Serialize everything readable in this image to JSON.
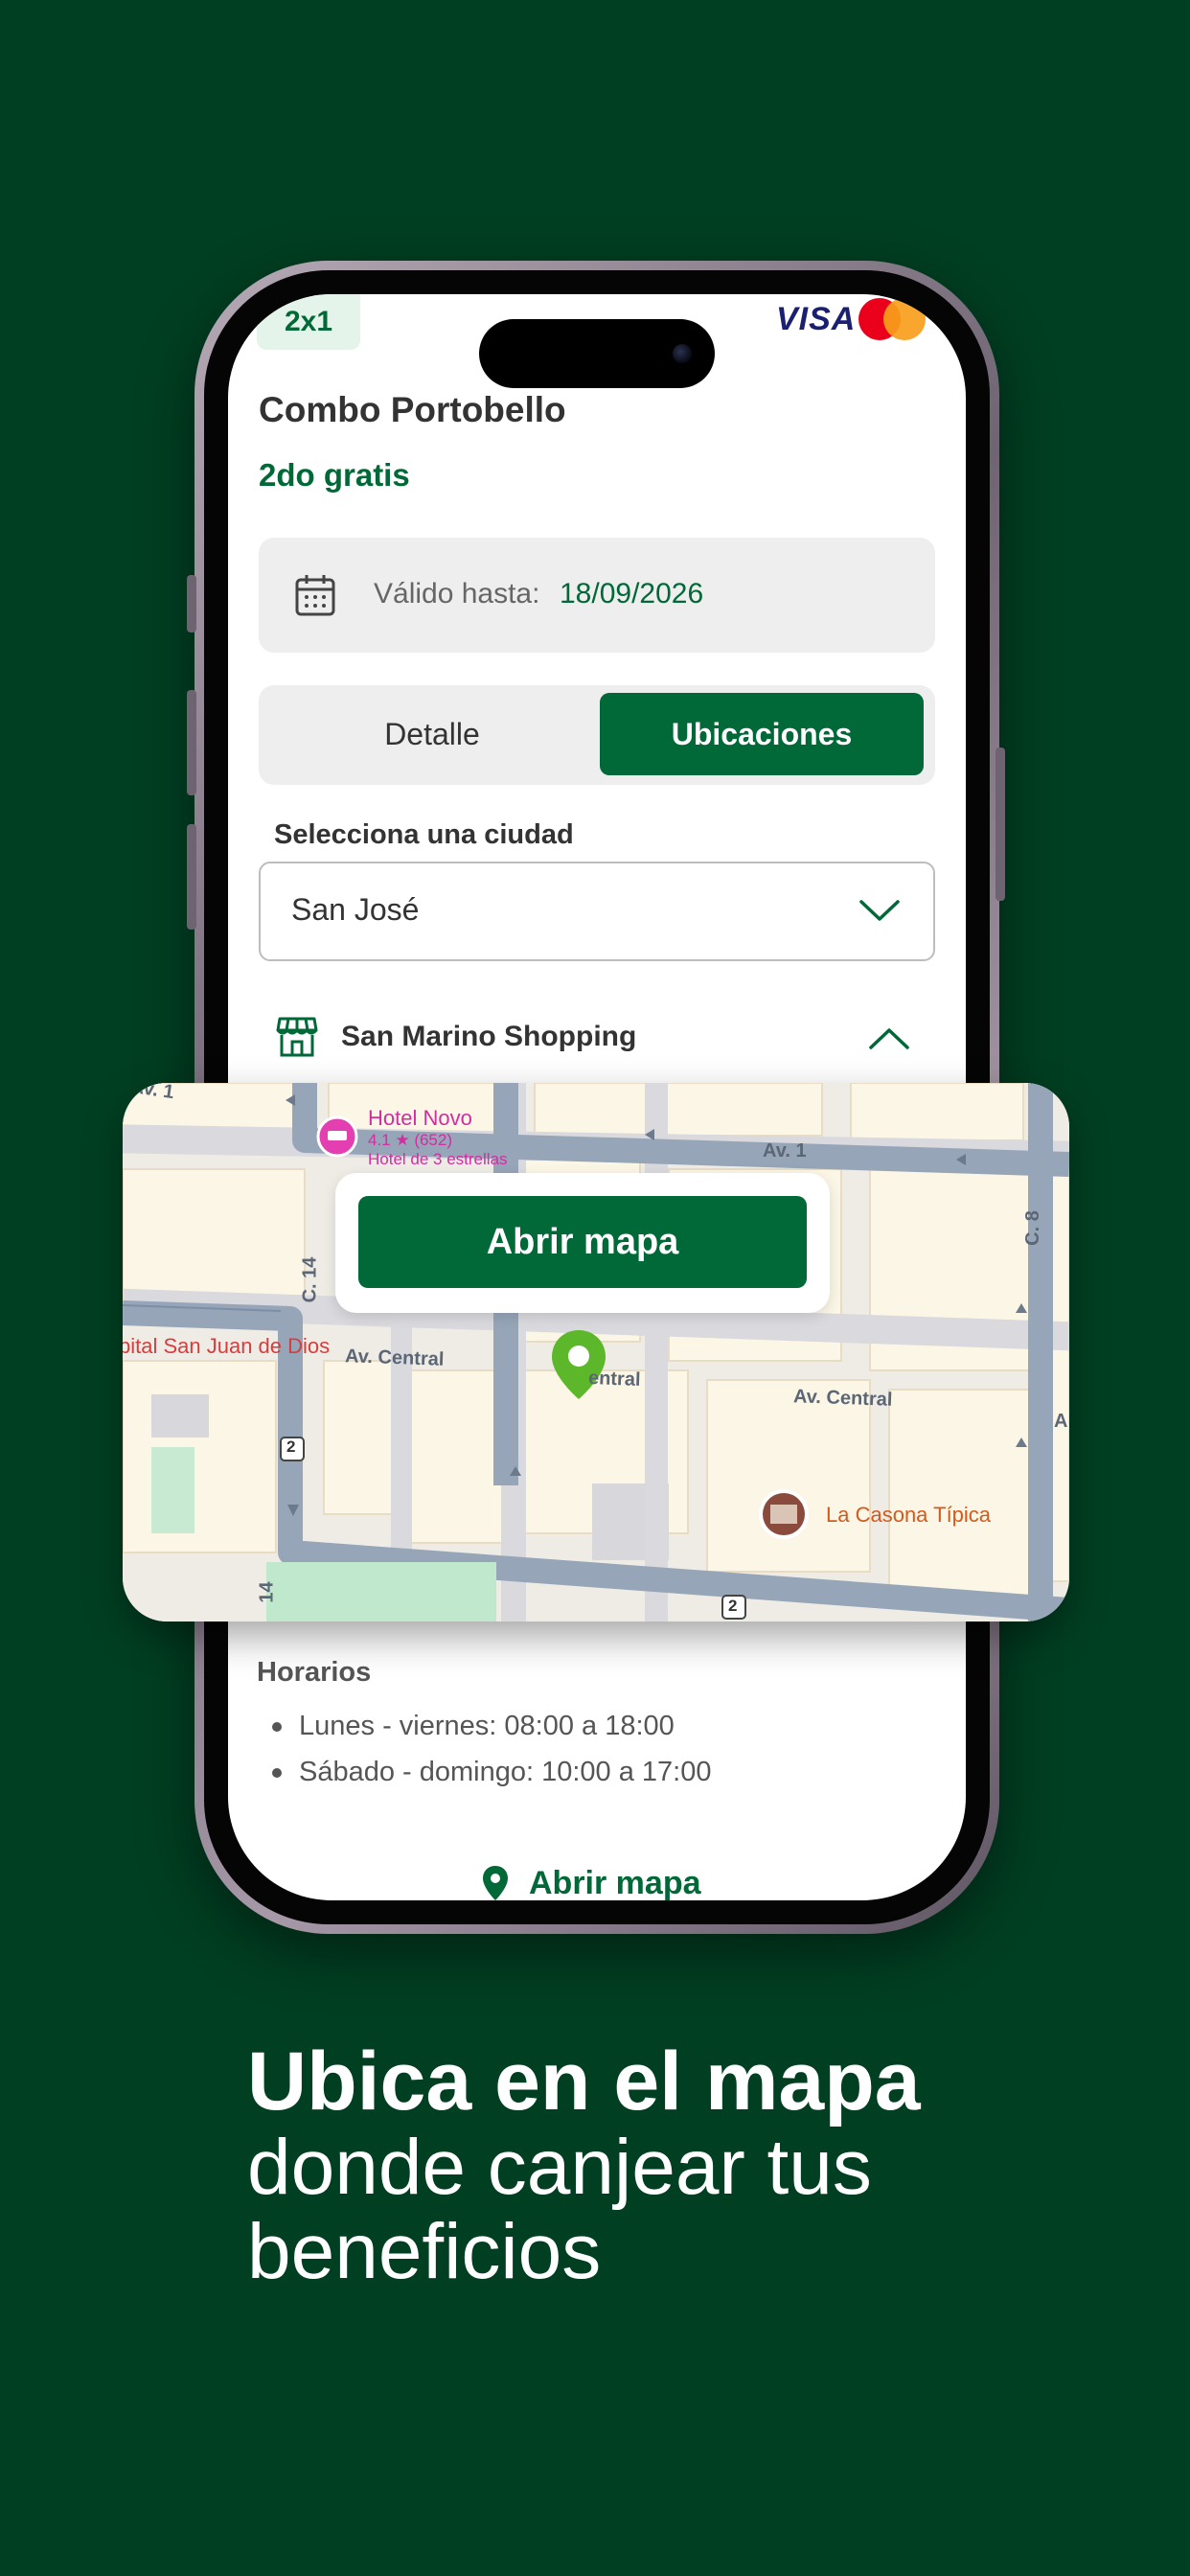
{
  "promo": {
    "badge": "2x1",
    "card_brand_visa": "VISA",
    "title": "Combo Portobello",
    "subtitle": "2do gratis"
  },
  "validity": {
    "label": "Válido hasta:",
    "date": "18/09/2026"
  },
  "tabs": [
    {
      "label": "Detalle",
      "active": false
    },
    {
      "label": "Ubicaciones",
      "active": true
    }
  ],
  "city": {
    "label": "Selecciona una ciudad",
    "selected": "San José"
  },
  "store": {
    "name": "San Marino Shopping",
    "icon": "storefront-icon"
  },
  "map": {
    "button_label": "Abrir mapa",
    "hotel_name": "Hotel Novo",
    "hotel_rating": "4.1 ★ (652)",
    "hotel_stars": "Hotel de 3 estrellas",
    "hospital": "pital San Juan de Dios",
    "casona": "La Casona Típica",
    "roads": {
      "av_central_1": "Av. Central",
      "av_central_2": "entral",
      "av_central_3": "Av. Central",
      "av1_left": "Av. 1",
      "av1_right": "Av. 1",
      "c14": "C. 14",
      "c14b": "14",
      "c8": "C. 8",
      "route2a": "2",
      "route2b": "2",
      "a": "A"
    }
  },
  "hours": {
    "title": "Horarios",
    "items": [
      "Lunes - viernes: 08:00 a 18:00",
      "Sábado - domingo: 10:00 a 17:00"
    ]
  },
  "bottom_link": "Abrir mapa",
  "headline": {
    "line1": "Ubica en el mapa",
    "line2": "donde canjear tus",
    "line3": "beneficios"
  },
  "colors": {
    "background": "#013f22",
    "brand_green": "#016837",
    "map_pin": "#5cb82a"
  }
}
